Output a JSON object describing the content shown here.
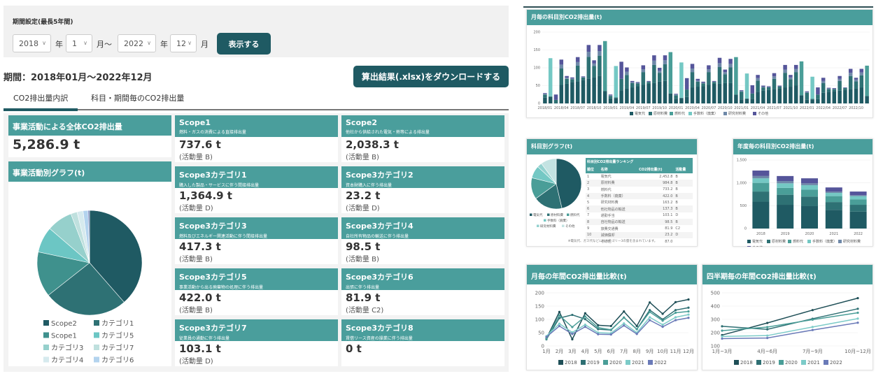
{
  "filter": {
    "label": "期間設定(最長5年間)",
    "start_year": "2018",
    "start_month": "1",
    "end_year": "2022",
    "end_month": "12",
    "year_unit": "年",
    "month_unit_from": "月～",
    "month_unit": "月",
    "show_button": "表示する"
  },
  "period_text": "期間：2018年01月～2022年12月",
  "download_button": "算出結果(.xlsx)をダウンロードする",
  "tabs": [
    {
      "label": "CO2排出量内訳",
      "active": true
    },
    {
      "label": "科目・期間毎のCO2排出量",
      "active": false
    }
  ],
  "total": {
    "title": "事業活動による全体CO2排出量",
    "value": "5,286.9 t"
  },
  "activity_graph_title": "事業活動別グラフ(t)",
  "cards": [
    {
      "title": "Scope1",
      "sub": "燃料・ガスの消費による直接排出量",
      "value": "737.6 t",
      "activity": "(活動量 B)"
    },
    {
      "title": "Scope2",
      "sub": "他社から供給された電気・熱等による排出量",
      "value": "2,038.3 t",
      "activity": "(活動量 B)"
    },
    {
      "title": "Scope3カテゴリ1",
      "sub": "購入した製品・サービスに伴う間接排出量",
      "value": "1,364.9 t",
      "activity": "(活動量 D)"
    },
    {
      "title": "Scope3カテゴリ2",
      "sub": "資本財購入に伴う排出量",
      "value": "23.2 t",
      "activity": "(活動量 D)"
    },
    {
      "title": "Scope3カテゴリ3",
      "sub": "燃料及びエネルギー関連活動に伴う間接排出量",
      "value": "417.3 t",
      "activity": "(活動量 B)"
    },
    {
      "title": "Scope3カテゴリ4",
      "sub": "自社所有物品の輸送に伴う排出量",
      "value": "98.5 t",
      "activity": "(活動量 B)"
    },
    {
      "title": "Scope3カテゴリ5",
      "sub": "事業活動から出る廃棄物の処理に伴う排出量",
      "value": "422.0 t",
      "activity": "(活動量 B)"
    },
    {
      "title": "Scope3カテゴリ6",
      "sub": "出張に伴う排出量",
      "value": "81.9 t",
      "activity": "(活動量 C2)"
    },
    {
      "title": "Scope3カテゴリ7",
      "sub": "従業員の通勤に伴う排出量",
      "value": "103.1 t",
      "activity": "(活動量 D)"
    },
    {
      "title": "Scope3カテゴリ8",
      "sub": "賃借リース資産の操業に伴う排出量",
      "value": "0 t",
      "activity": ""
    }
  ],
  "colors": {
    "teal_header": "#4a9e9c",
    "dark_button": "#1f5a63"
  },
  "chart_data": [
    {
      "id": "activity_pie",
      "type": "pie",
      "title": "事業活動別グラフ(t)",
      "labels": [
        "Scope2",
        "カテゴリ1",
        "Scope1",
        "カテゴリ5",
        "カテゴリ3",
        "カテゴリ7",
        "カテゴリ4",
        "カテゴリ6",
        "カテゴリ2"
      ],
      "values": [
        2038.3,
        1364.9,
        737.6,
        422.0,
        417.3,
        103.1,
        98.5,
        81.9,
        23.2
      ],
      "colors": [
        "#1f5a63",
        "#2e7174",
        "#3f918d",
        "#6cc6c4",
        "#96d0cc",
        "#bfe0de",
        "#d6eaee",
        "#b3d3ee",
        "#6a7ab8"
      ],
      "legend": "bottom"
    },
    {
      "id": "monthly_stacked",
      "type": "bar",
      "stacked": true,
      "title": "月毎の科目別CO2排出量(t)",
      "ylim": [
        0,
        200
      ],
      "yticks": [
        0,
        50,
        100,
        150,
        200
      ],
      "xtick_labels": [
        "2018/01",
        "2018/04",
        "2018/07",
        "2018/10",
        "2019/01",
        "2019/04",
        "2019/07",
        "2019/10",
        "2020/01",
        "2020/04",
        "2020/07",
        "2020/10",
        "2021/01",
        "2021/04",
        "2021/07",
        "2021/10",
        "2022/01",
        "2022/04",
        "2022/07",
        "2022/10"
      ],
      "series": [
        {
          "name": "電気代",
          "color": "#1f5a63",
          "values": [
            16,
            18,
            0,
            52,
            55,
            60,
            62,
            66,
            70,
            74,
            78,
            35,
            14,
            15,
            37,
            42,
            45,
            48,
            52,
            55,
            57,
            61,
            63,
            28,
            13,
            14,
            18,
            45,
            47,
            48,
            52,
            55,
            55,
            57,
            57,
            25,
            11,
            12,
            13,
            33,
            36,
            38,
            40,
            42,
            45,
            47,
            50,
            23,
            10,
            11,
            12,
            30,
            33,
            35,
            36,
            38,
            40,
            42,
            45,
            21
          ]
        },
        {
          "name": "原材料費",
          "color": "#2e7174",
          "values": [
            9,
            2,
            10,
            46,
            14,
            8,
            44,
            7,
            61,
            31,
            56,
            0,
            7,
            2,
            32,
            38,
            12,
            8,
            36,
            5,
            51,
            25,
            47,
            0,
            10,
            2,
            21,
            43,
            14,
            8,
            36,
            5,
            47,
            25,
            44,
            0,
            22,
            2,
            15,
            31,
            9,
            7,
            29,
            5,
            41,
            21,
            38,
            0,
            20,
            2,
            13,
            27,
            7,
            5,
            27,
            5,
            37,
            20,
            34,
            0
          ]
        },
        {
          "name": "燃料代",
          "color": "#4a9e98",
          "values": [
            0,
            0,
            0,
            0,
            0,
            0,
            0,
            0,
            0,
            0,
            0,
            140,
            0,
            0,
            0,
            0,
            0,
            0,
            0,
            0,
            0,
            0,
            0,
            116,
            0,
            0,
            0,
            0,
            0,
            0,
            0,
            0,
            0,
            0,
            0,
            105,
            0,
            0,
            0,
            0,
            0,
            0,
            0,
            0,
            0,
            0,
            0,
            95,
            0,
            0,
            0,
            0,
            0,
            0,
            0,
            0,
            0,
            0,
            0,
            85
          ]
        },
        {
          "name": "手数料（廃棄）",
          "color": "#74c8c4",
          "values": [
            0,
            107,
            0,
            0,
            0,
            0,
            0,
            0,
            0,
            0,
            0,
            0,
            0,
            88,
            0,
            0,
            0,
            0,
            0,
            0,
            0,
            0,
            0,
            0,
            0,
            99,
            0,
            0,
            0,
            0,
            0,
            0,
            0,
            0,
            0,
            0,
            0,
            70,
            0,
            0,
            0,
            0,
            0,
            0,
            0,
            0,
            0,
            0,
            0,
            62,
            0,
            0,
            0,
            0,
            0,
            0,
            0,
            0,
            0,
            0
          ]
        },
        {
          "name": "研究材料費",
          "color": "#6e88a8",
          "values": [
            2,
            0,
            0,
            11,
            3,
            2,
            10,
            1,
            14,
            7,
            13,
            0,
            2,
            0,
            0,
            9,
            3,
            2,
            8,
            1,
            12,
            6,
            11,
            0,
            2,
            0,
            0,
            10,
            3,
            2,
            8,
            1,
            11,
            6,
            10,
            0,
            2,
            0,
            0,
            7,
            2,
            1,
            7,
            1,
            9,
            5,
            9,
            0,
            2,
            0,
            0,
            6,
            2,
            1,
            6,
            1,
            9,
            5,
            8,
            0
          ]
        },
        {
          "name": "その他",
          "color": "#55559a",
          "values": [
            2,
            0,
            15,
            14,
            5,
            3,
            14,
            2,
            19,
            9,
            17,
            0,
            2,
            0,
            48,
            12,
            3,
            2,
            11,
            2,
            15,
            8,
            14,
            0,
            2,
            0,
            32,
            13,
            5,
            3,
            11,
            2,
            15,
            7,
            14,
            0,
            2,
            0,
            23,
            9,
            3,
            2,
            9,
            2,
            13,
            7,
            11,
            0,
            2,
            0,
            20,
            9,
            2,
            2,
            8,
            1,
            11,
            5,
            10,
            0
          ]
        }
      ],
      "legend": "bottom"
    },
    {
      "id": "category_pie",
      "type": "pie",
      "title": "科目別グラフ(t)",
      "labels": [
        "電気代",
        "原材料費",
        "燃料代",
        "手数料（廃棄）",
        "研究材料費",
        "その他"
      ],
      "values": [
        2452.8,
        984.8,
        733.2,
        422.0,
        163.2,
        530.9
      ],
      "colors": [
        "#1f5a63",
        "#2e7174",
        "#4a9e98",
        "#74c8c4",
        "#94d2cf",
        "#c3e3e2"
      ],
      "legend": "bottom"
    },
    {
      "id": "ranking_table",
      "type": "table",
      "title": "科目別CO2排出量ランキング",
      "columns": [
        "順位",
        "名称",
        "CO2排出量(t)",
        "活動量"
      ],
      "rows": [
        [
          "1",
          "電気代",
          "2,452.8",
          "B"
        ],
        [
          "2",
          "原材料費",
          "984.8",
          "B"
        ],
        [
          "3",
          "燃料代",
          "733.2",
          "B"
        ],
        [
          "4",
          "手数料（廃棄）",
          "422.0",
          "B"
        ],
        [
          "5",
          "研究材料費",
          "163.2",
          "B"
        ],
        [
          "6",
          "他社物品の輸送",
          "137.3",
          "B"
        ],
        [
          "7",
          "通勤手当",
          "103.1",
          "D"
        ],
        [
          "8",
          "自社物品の輸送",
          "98.5",
          "B"
        ],
        [
          "9",
          "旅費交通費",
          "81.9",
          "C2"
        ],
        [
          "10",
          "減価償却",
          "23.2",
          "D"
        ],
        [
          "",
          "その他",
          "87.0",
          ""
        ]
      ],
      "note": "※電気代、ガス代などにはカテゴリー3の量を含まれています。"
    },
    {
      "id": "annual_stacked",
      "type": "bar",
      "stacked": true,
      "title": "年度毎の科目別CO2排出量(t)",
      "categories": [
        "2018",
        "2019",
        "2020",
        "2021",
        "2022"
      ],
      "ylim": [
        0,
        1500
      ],
      "yticks": [
        0,
        500,
        1000,
        1500
      ],
      "ytick_labels": [
        "0",
        "500",
        "1,000",
        "1,500"
      ],
      "series": [
        {
          "name": "電気代",
          "color": "#1f5a63",
          "values": [
            590,
            520,
            490,
            410,
            370
          ]
        },
        {
          "name": "原材料費",
          "color": "#2e7174",
          "values": [
            220,
            220,
            210,
            170,
            150
          ]
        },
        {
          "name": "燃料代",
          "color": "#4a9e98",
          "values": [
            190,
            150,
            150,
            130,
            120
          ]
        },
        {
          "name": "手数料（廃棄）",
          "color": "#74c8c4",
          "values": [
            100,
            100,
            100,
            70,
            70
          ]
        },
        {
          "name": "研究材料費",
          "color": "#6e88a8",
          "values": [
            50,
            50,
            40,
            30,
            20
          ]
        },
        {
          "name": "その他",
          "color": "#55559a",
          "values": [
            120,
            110,
            110,
            90,
            80
          ]
        }
      ],
      "legend": "bottom"
    },
    {
      "id": "monthly_yoy",
      "type": "line",
      "title": "月毎の年間CO2排出量比較(t)",
      "categories": [
        "1月",
        "2月",
        "3月",
        "4月",
        "5月",
        "6月",
        "7月",
        "8月",
        "9月",
        "10月",
        "11月",
        "12月"
      ],
      "ylim": [
        0,
        200
      ],
      "yticks": [
        0,
        50,
        100,
        150,
        200
      ],
      "series": [
        {
          "name": "2018",
          "color": "#1f4f57",
          "values": [
            28,
            128,
            25,
            123,
            78,
            75,
            130,
            75,
            164,
            121,
            165,
            175
          ]
        },
        {
          "name": "2019",
          "color": "#2e6f73",
          "values": [
            25,
            105,
            117,
            101,
            63,
            60,
            107,
            63,
            135,
            100,
            135,
            144
          ]
        },
        {
          "name": "2020",
          "color": "#4a9e98",
          "values": [
            27,
            115,
            71,
            111,
            69,
            61,
            107,
            63,
            128,
            95,
            125,
            130
          ]
        },
        {
          "name": "2021",
          "color": "#7ccbc8",
          "values": [
            37,
            84,
            51,
            80,
            50,
            48,
            85,
            50,
            108,
            80,
            108,
            118
          ]
        },
        {
          "name": "2022",
          "color": "#6a7ab8",
          "values": [
            34,
            75,
            45,
            72,
            44,
            43,
            77,
            45,
            97,
            72,
            97,
            106
          ]
        }
      ],
      "legend": "bottom"
    },
    {
      "id": "quarterly_yoy",
      "type": "line",
      "title": "四半期毎の年間CO2排出量比較(t)",
      "categories": [
        "1月~3月",
        "4月~6月",
        "7月~9月",
        "10月~12月"
      ],
      "ylim": [
        100,
        500
      ],
      "yticks": [
        100,
        200,
        300,
        400,
        500
      ],
      "series": [
        {
          "name": "2018",
          "color": "#1f4f57",
          "values": [
            182,
            273,
            370,
            460
          ]
        },
        {
          "name": "2019",
          "color": "#2e6f73",
          "values": [
            248,
            225,
            305,
            380
          ]
        },
        {
          "name": "2020",
          "color": "#4a9e98",
          "values": [
            215,
            242,
            298,
            350
          ]
        },
        {
          "name": "2021",
          "color": "#7ccbc8",
          "values": [
            172,
            178,
            243,
            306
          ]
        },
        {
          "name": "2022",
          "color": "#6a7ab8",
          "values": [
            155,
            160,
            220,
            275
          ]
        }
      ],
      "legend": "bottom"
    }
  ]
}
